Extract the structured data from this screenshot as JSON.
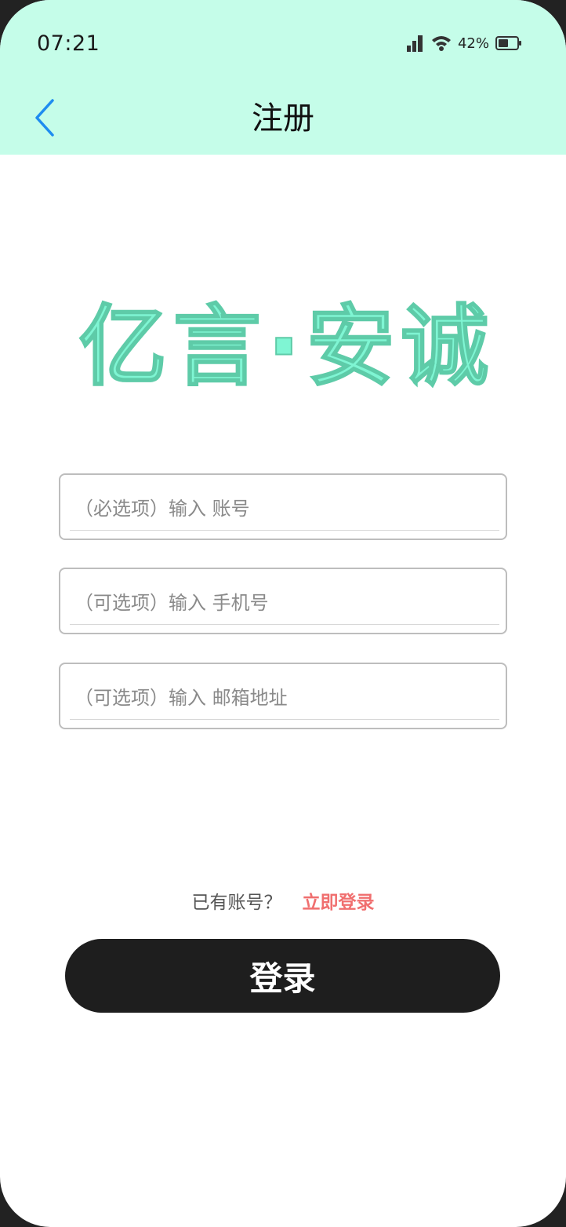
{
  "status_bar": {
    "time": "07:21",
    "battery": "42%"
  },
  "nav": {
    "title": "注册"
  },
  "logo": {
    "text": "亿言·安诚",
    "color": "#7ff5d3"
  },
  "form": {
    "account_placeholder": "（必选项）输入 账号",
    "phone_placeholder": "（可选项）输入 手机号",
    "email_placeholder": "（可选项）输入 邮箱地址"
  },
  "login_hint": {
    "question": "已有账号？",
    "link": "立即登录"
  },
  "primary_button": {
    "label": "登录"
  },
  "colors": {
    "header_bg": "#c5fde9",
    "back_icon": "#1e8cf0",
    "link": "#f06f6f",
    "button_bg": "#1e1e1e"
  }
}
